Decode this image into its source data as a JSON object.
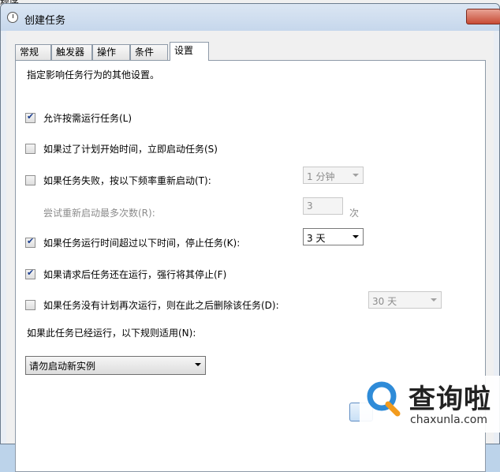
{
  "background": {
    "app_title": "程序"
  },
  "window": {
    "title": "创建任务"
  },
  "tabs": [
    {
      "label": "常规"
    },
    {
      "label": "触发器"
    },
    {
      "label": "操作"
    },
    {
      "label": "条件"
    },
    {
      "label": "设置"
    }
  ],
  "settings": {
    "intro": "指定影响任务行为的其他设置。",
    "allow_on_demand": {
      "label": "允许按需运行任务(L)",
      "checked": true
    },
    "run_asap_missed": {
      "label": "如果过了计划开始时间，立即启动任务(S)",
      "checked": false
    },
    "restart_on_fail": {
      "label": "如果任务失败，按以下频率重新启动(T):",
      "checked": false,
      "interval": "1 分钟"
    },
    "restart_attempts": {
      "label": "尝试重新启动最多次数(R):",
      "value": "3",
      "unit": "次"
    },
    "stop_if_longer": {
      "label": "如果任务运行时间超过以下时间，停止任务(K):",
      "checked": true,
      "duration": "3 天"
    },
    "force_stop": {
      "label": "如果请求后任务还在运行，强行将其停止(F)",
      "checked": true
    },
    "delete_if_not_scheduled": {
      "label": "如果任务没有计划再次运行，则在此之后删除该任务(D):",
      "checked": false,
      "after": "30 天"
    },
    "already_running_rule": {
      "label": "如果此任务已经运行，以下规则适用(N):",
      "value": "请勿启动新实例"
    }
  },
  "watermark": {
    "title": "查询啦",
    "subtitle": "chaxunla.com"
  },
  "colors": {
    "accent": "#1a3d8f",
    "disabled_text": "#8c8c8c",
    "watermark_blue": "#2e8bd8"
  }
}
